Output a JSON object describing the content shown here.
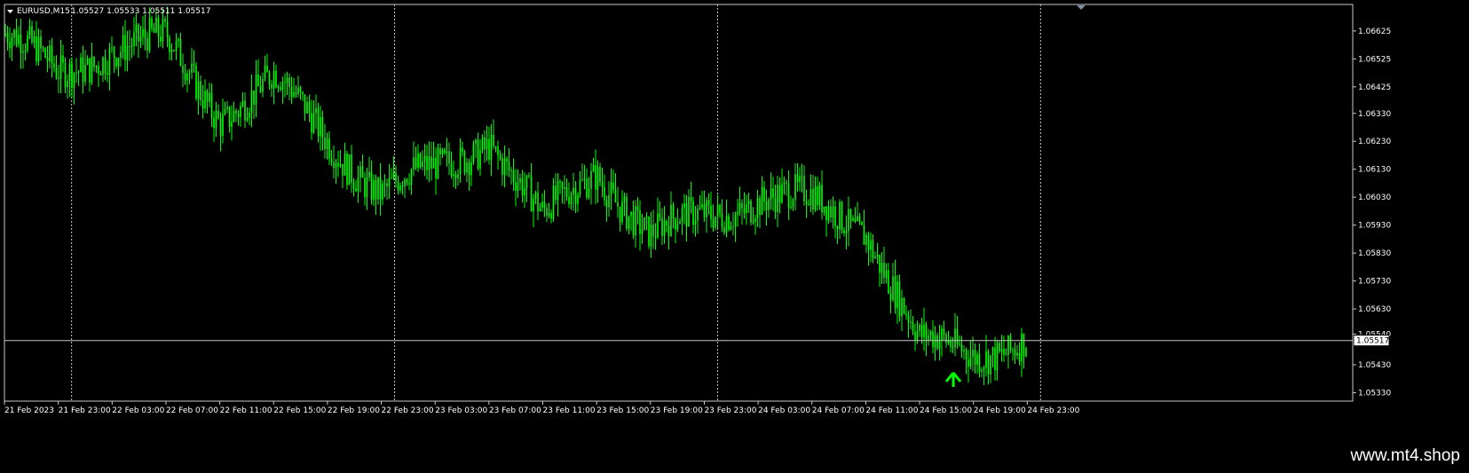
{
  "header": {
    "symbol_text": "EURUSD,M15",
    "ohlc_text": "1.05527 1.05533 1.05511 1.05517"
  },
  "watermark": "www.mt4.shop",
  "colors": {
    "background": "#000000",
    "candle": "#00ff00",
    "grid": "#c8c8c8",
    "frame": "#c8c8c8",
    "text": "#ffffff",
    "arrow": "#00ff00"
  },
  "icons": {
    "collapse_menu": "triangle-down-icon",
    "signal": "arrow-up-icon",
    "shift": "triangle-down-marker-icon"
  },
  "chart_data": {
    "type": "line",
    "title": "EURUSD,M15",
    "ylim": [
      1.053,
      1.0672
    ],
    "y_ticks": [
      "1.06625",
      "1.06525",
      "1.06425",
      "1.06330",
      "1.06230",
      "1.06130",
      "1.06030",
      "1.05930",
      "1.05830",
      "1.05730",
      "1.05630",
      "1.05540",
      "1.05430",
      "1.05330"
    ],
    "x_ticks": [
      "21 Feb 2023",
      "21 Feb 23:00",
      "22 Feb 03:00",
      "22 Feb 07:00",
      "22 Feb 11:00",
      "22 Feb 15:00",
      "22 Feb 19:00",
      "22 Feb 23:00",
      "23 Feb 03:00",
      "23 Feb 07:00",
      "23 Feb 11:00",
      "23 Feb 15:00",
      "23 Feb 19:00",
      "23 Feb 23:00",
      "24 Feb 03:00",
      "24 Feb 07:00",
      "24 Feb 11:00",
      "24 Feb 15:00",
      "24 Feb 19:00",
      "24 Feb 23:00"
    ],
    "day_separators": [
      "21 Feb 23:00",
      "22 Feb 23:00",
      "23 Feb 23:00",
      "24 Feb 23:00"
    ],
    "current_price": "1.05517",
    "grid": false,
    "series": [
      {
        "x": [
          "21 Feb 2023",
          "21 Feb 23:00",
          "22 Feb 03:00",
          "22 Feb 07:00",
          "22 Feb 11:00",
          "22 Feb 15:00",
          "22 Feb 19:00",
          "22 Feb 23:00",
          "23 Feb 03:00",
          "23 Feb 07:00",
          "23 Feb 11:00",
          "23 Feb 15:00",
          "23 Feb 19:00",
          "23 Feb 23:00",
          "24 Feb 03:00",
          "24 Feb 07:00",
          "24 Feb 11:00",
          "24 Feb 15:00",
          "24 Feb 19:00",
          "24 Feb 23:00"
        ],
        "close": [
          1.0661,
          1.0647,
          1.0657,
          1.0658,
          1.0633,
          1.0645,
          1.0624,
          1.0605,
          1.0612,
          1.0625,
          1.0594,
          1.0614,
          1.0588,
          1.0597,
          1.0603,
          1.0601,
          1.0593,
          1.055,
          1.0548,
          1.0552
        ]
      }
    ],
    "signal_arrow_at": "24 Feb 15:00"
  }
}
